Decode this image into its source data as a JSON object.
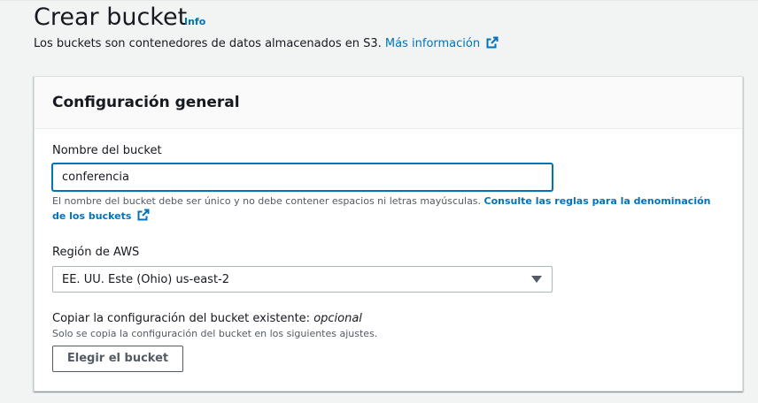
{
  "header": {
    "title": "Crear bucket",
    "info_label": "Info",
    "description": "Los buckets son contenedores de datos almacenados en S3.",
    "more_info_link": "Más información"
  },
  "general_config": {
    "title": "Configuración general",
    "bucket_name": {
      "label": "Nombre del bucket",
      "value": "conferencia",
      "hint": "El nombre del bucket debe ser único y no debe contener espacios ni letras mayúsculas.",
      "hint_link": "Consulte las reglas para la denominación de los buckets"
    },
    "region": {
      "label": "Región de AWS",
      "selected": "EE. UU. Este (Ohio) us-east-2"
    },
    "copy_config": {
      "label": "Copiar la configuración del bucket existente:",
      "label_optional": "opcional",
      "hint": "Solo se copia la configuración del bucket en los siguientes ajustes.",
      "button_label": "Elegir el bucket"
    }
  },
  "colors": {
    "link": "#0073bb",
    "text": "#16191f",
    "secondary_text": "#545b64",
    "background": "#f2f3f3"
  },
  "icons": {
    "external_link": "external-link-icon",
    "dropdown": "caret-down-icon"
  }
}
